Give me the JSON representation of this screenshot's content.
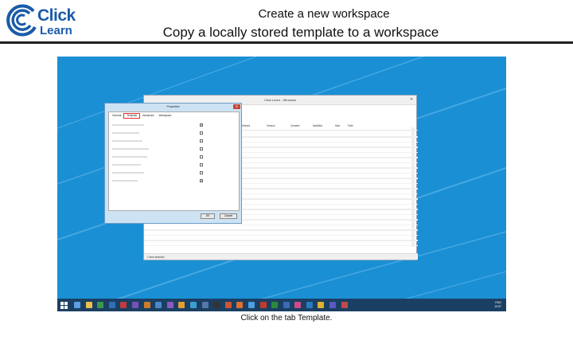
{
  "header": {
    "logo_click": "Click",
    "logo_learn": "Learn",
    "title_line1": "Create a new workspace",
    "title_line2": "Copy a locally stored template to a workspace",
    "logo_icon": "cl-swirl-logo"
  },
  "colors": {
    "brand_blue": "#1a5ba8",
    "desktop_blue": "#1a8fd4",
    "taskbar": "#1b3f63",
    "tab_highlight": "#dd3333"
  },
  "app_window": {
    "title": "Click Learn - Windows",
    "columns": [
      "",
      "Defined",
      "Version",
      "Created",
      "Modified",
      "Size",
      "Path"
    ],
    "status_bar": "1 item selected"
  },
  "dialog": {
    "title": "Properties",
    "tabs": [
      "General",
      "Template",
      "Advanced",
      "Workspace"
    ],
    "selected_tab": "Template",
    "ok_label": "OK",
    "cancel_label": "Cancel"
  },
  "taskbar": {
    "tray_lang": "ENG",
    "tray_time": "10:57"
  },
  "caption": {
    "prefix": "Click on the tab ",
    "bold": "Template",
    "suffix": "."
  }
}
